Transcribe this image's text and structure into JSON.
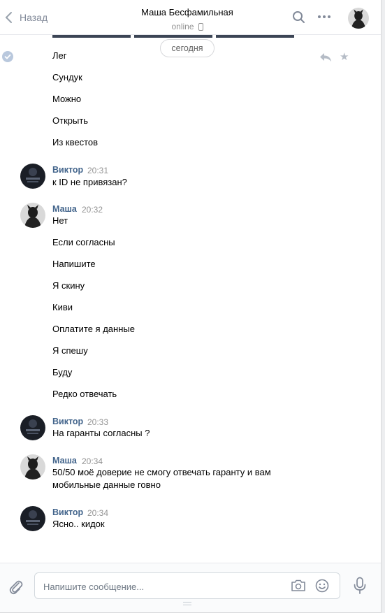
{
  "header": {
    "back_label": "Назад",
    "peer_name": "Маша Бесфамильная",
    "peer_status": "online"
  },
  "date_separator": "сегодня",
  "messages": {
    "m1": "Лег",
    "m2": "Сундук",
    "m3": "Можно",
    "m4": "Открыть",
    "m5": "Из квестов",
    "g1_author": "Виктор",
    "g1_time": "20:31",
    "g1_text": "к ID не привязан?",
    "g2_author": "Маша",
    "g2_time": "20:32",
    "g2_t1": "Нет",
    "g2_t2": "Если согласны",
    "g2_t3": "Напишите",
    "g2_t4": "Я скину",
    "g2_t5": "Киви",
    "g2_t6": "Оплатите я данные",
    "g2_t7": "Я спешу",
    "g2_t8": "Буду",
    "g2_t9": "Редко отвечать",
    "g3_author": "Виктор",
    "g3_time": "20:33",
    "g3_text": "На гаранты согласны ?",
    "g4_author": "Маша",
    "g4_time": "20:34",
    "g4_text": "50/50 моё доверие не смогу отвечать гаранту и вам мобильные данные говно",
    "g5_author": "Виктор",
    "g5_time": "20:34",
    "g5_text": "Ясно.. кидок"
  },
  "composer": {
    "placeholder": "Напишите сообщение..."
  },
  "colors": {
    "author": "#42648b",
    "muted": "#939393",
    "icon": "#828a99"
  }
}
